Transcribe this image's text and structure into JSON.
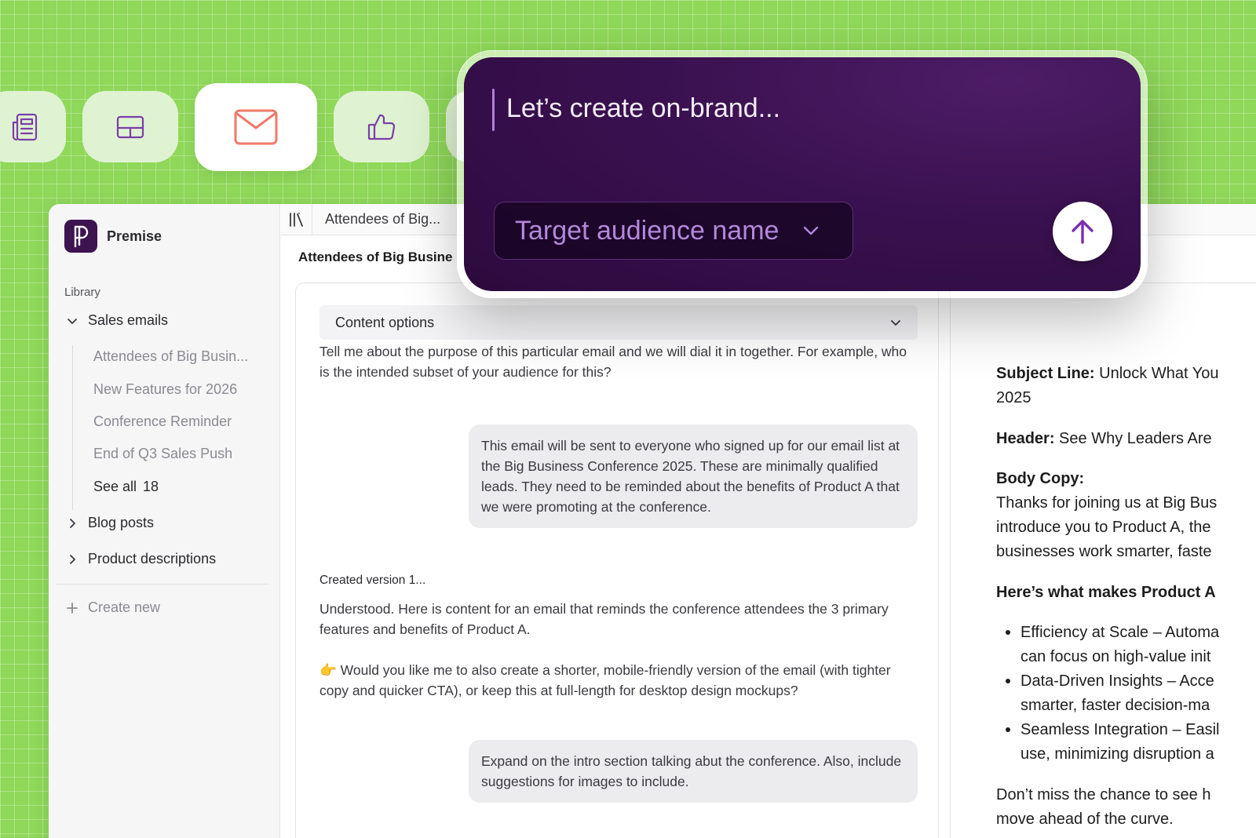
{
  "categories": [
    {
      "icon": "newspaper-icon",
      "active": false
    },
    {
      "icon": "layout-icon",
      "active": false
    },
    {
      "icon": "mail-icon",
      "active": true
    },
    {
      "icon": "thumbs-up-icon",
      "active": false
    }
  ],
  "brand": {
    "name": "Premise"
  },
  "sidebar": {
    "library_label": "Library",
    "groups": [
      {
        "label": "Sales emails",
        "expanded": true
      },
      {
        "label": "Blog posts",
        "expanded": false
      },
      {
        "label": "Product descriptions",
        "expanded": false
      }
    ],
    "sales_email_items": [
      "Attendees of Big Busin...",
      "New Features for 2026",
      "Conference Reminder",
      "End of Q3 Sales Push"
    ],
    "see_all": {
      "label": "See all",
      "count": "18"
    },
    "create_new": "Create new"
  },
  "tabbar": {
    "active_tab": "Attendees of Big..."
  },
  "document": {
    "title": "Attendees of Big Busine"
  },
  "chat": {
    "content_options": "Content options",
    "assistant_prompt": "Tell me about the purpose of this particular email and we will dial it in together. For example, who is the intended subset of your audience for this?",
    "user_message_1": "This email will be sent to everyone who signed up for our email list at the Big Business Conference 2025. These are minimally qualified leads. They need to be reminded about the benefits of Product A that we were promoting at the conference.",
    "created_label": "Created version 1...",
    "assistant_reply": "Understood. Here is content for an email that reminds the conference attendees the 3 primary features and benefits of Product A.",
    "assistant_followup": "👉 Would you like me to also create a shorter, mobile-friendly version of the email (with tighter copy and quicker CTA), or keep this at full-length for desktop design mockups?",
    "user_message_2": "Expand on the intro section talking abut the conference. Also, include suggestions for images to include."
  },
  "preview": {
    "subject_label": "Subject Line:",
    "subject_text": "Unlock What You",
    "subject_cont": "2025",
    "header_label": "Header:",
    "header_text": "See Why Leaders Are",
    "body_label": "Body Copy:",
    "body_lines": [
      "Thanks for joining us at Big Bus",
      "introduce you to Product A, the",
      "businesses work smarter, faste"
    ],
    "features_heading": "Here’s what makes Product A",
    "features": [
      [
        "Efficiency at Scale – Automa",
        "can focus on high-value init"
      ],
      [
        "Data-Driven Insights – Acce",
        "smarter, faster decision-ma"
      ],
      [
        "Seamless Integration – Easil",
        "use, minimizing disruption a"
      ]
    ],
    "closing_lines": [
      "Don’t miss the chance to see h",
      "move ahead of the curve."
    ]
  },
  "prompt": {
    "text": "Let’s create on-brand...",
    "audience_select": "Target audience name",
    "send_icon": "arrow-up-icon"
  },
  "colors": {
    "background": "#8fd85a",
    "accent_mail": "#f07a6a",
    "accent_purple": "#7b3fa6",
    "prompt_bg": "#3a1150"
  }
}
